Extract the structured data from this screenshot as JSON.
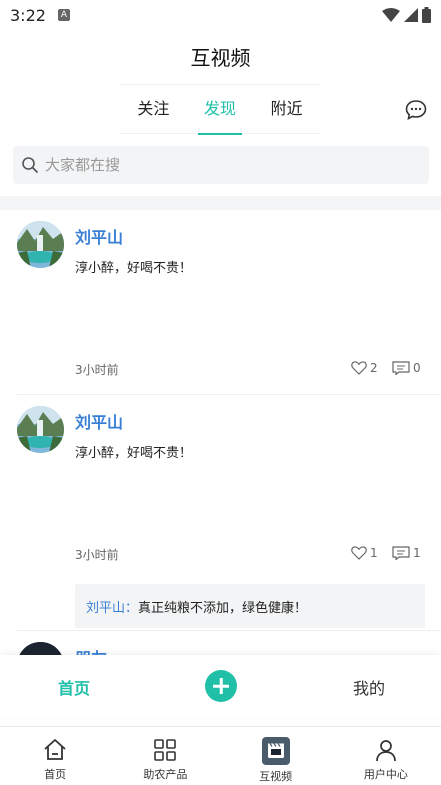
{
  "status_bar": {
    "time": "3:22",
    "notif_icon": "A"
  },
  "header": {
    "title": "互视频"
  },
  "tabs": [
    {
      "label": "关注",
      "active": false
    },
    {
      "label": "发现",
      "active": true
    },
    {
      "label": "附近",
      "active": false
    }
  ],
  "search": {
    "placeholder": "大家都在搜"
  },
  "posts": [
    {
      "author": "刘平山",
      "text": "淳小醉，好喝不贵！",
      "time": "3小时前",
      "likes": "2",
      "comments": "0"
    },
    {
      "author": "刘平山",
      "text": "淳小醉，好喝不贵！",
      "time": "3小时前",
      "likes": "1",
      "comments": "1",
      "comment": {
        "user": "刘平山：",
        "text": "真正纯粮不添加，绿色健康！"
      }
    },
    {
      "author": "朋友"
    }
  ],
  "sub_nav": {
    "home": "首页",
    "mine": "我的"
  },
  "bottom_nav": [
    {
      "label": "首页",
      "icon": "home-icon"
    },
    {
      "label": "助农产品",
      "icon": "grid-icon"
    },
    {
      "label": "互视频",
      "icon": "video-icon"
    },
    {
      "label": "用户中心",
      "icon": "user-icon"
    }
  ],
  "colors": {
    "accent": "#20c0a8",
    "link": "#3a7fd6"
  }
}
